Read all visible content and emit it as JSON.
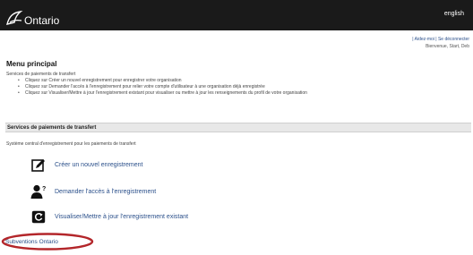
{
  "header": {
    "logo_text": "Ontario",
    "language_link": "english"
  },
  "user_links": {
    "links": "| Aidez-moi | Se déconnecter",
    "welcome": "Bienvenue, Start, Deb"
  },
  "main_menu": {
    "title": "Menu principal",
    "intro": "Services de paiements de transfert",
    "bullets": [
      "Cliquez sur Créer un nouvel enregistrement pour enregistrer votre organisation",
      "Cliquez sur Demander l'accès à l'enregistrement pour relier votre compte d'utilisateur à une organisation déjà enregistrée",
      "Cliquez sur Visualiser/Mettre à jour l'enregistrement existant pour visualiser ou mettre à jour les renseignements du profil de votre organisation"
    ]
  },
  "section": {
    "title": "Services de paiements de transfert",
    "subtitle": "Système central d'enregistrement pour les paiements de transfert"
  },
  "actions": [
    {
      "label": "Créer un nouvel enregistrement",
      "icon": "edit-icon"
    },
    {
      "label": "Demander l'accès à l'enregistrement",
      "icon": "user-question-icon"
    },
    {
      "label": "Visualiser/Mettre à jour l'enregistrement existant",
      "icon": "refresh-icon"
    }
  ],
  "footer_link": "Subventions Ontario",
  "colors": {
    "header_bg": "#1a1a1a",
    "link": "#2a4f8a",
    "highlight_ring": "#b3262a",
    "section_bar": "#e8e8e8"
  }
}
